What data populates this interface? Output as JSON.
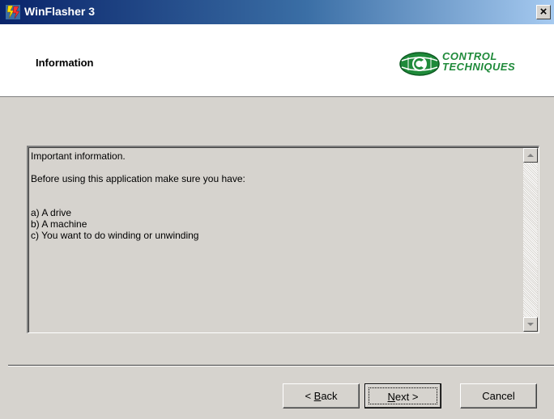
{
  "window": {
    "title": "WinFlasher 3",
    "close_glyph": "×"
  },
  "header": {
    "title": "Information",
    "logo_line1": "CONTROL",
    "logo_line2": "TECHNIQUES",
    "logo_color": "#1f8a3a"
  },
  "content": {
    "lines": [
      "Important information.",
      "Before using this application make sure you have:",
      "a) A drive",
      "b) A machine",
      "c) You want to do winding or unwinding"
    ]
  },
  "buttons": {
    "back_prefix": "< ",
    "back_mnemonic": "B",
    "back_rest": "ack",
    "next_mnemonic": "N",
    "next_rest": "ext >",
    "cancel": "Cancel"
  },
  "icons": {
    "app": "winflasher-app-icon",
    "close": "close-icon",
    "logo": "control-techniques-logo",
    "scroll_up": "arrow-up-icon",
    "scroll_down": "arrow-down-icon"
  },
  "colors": {
    "titlebar_start": "#0a246a",
    "titlebar_end": "#a6caf0",
    "face": "#d6d3ce"
  }
}
